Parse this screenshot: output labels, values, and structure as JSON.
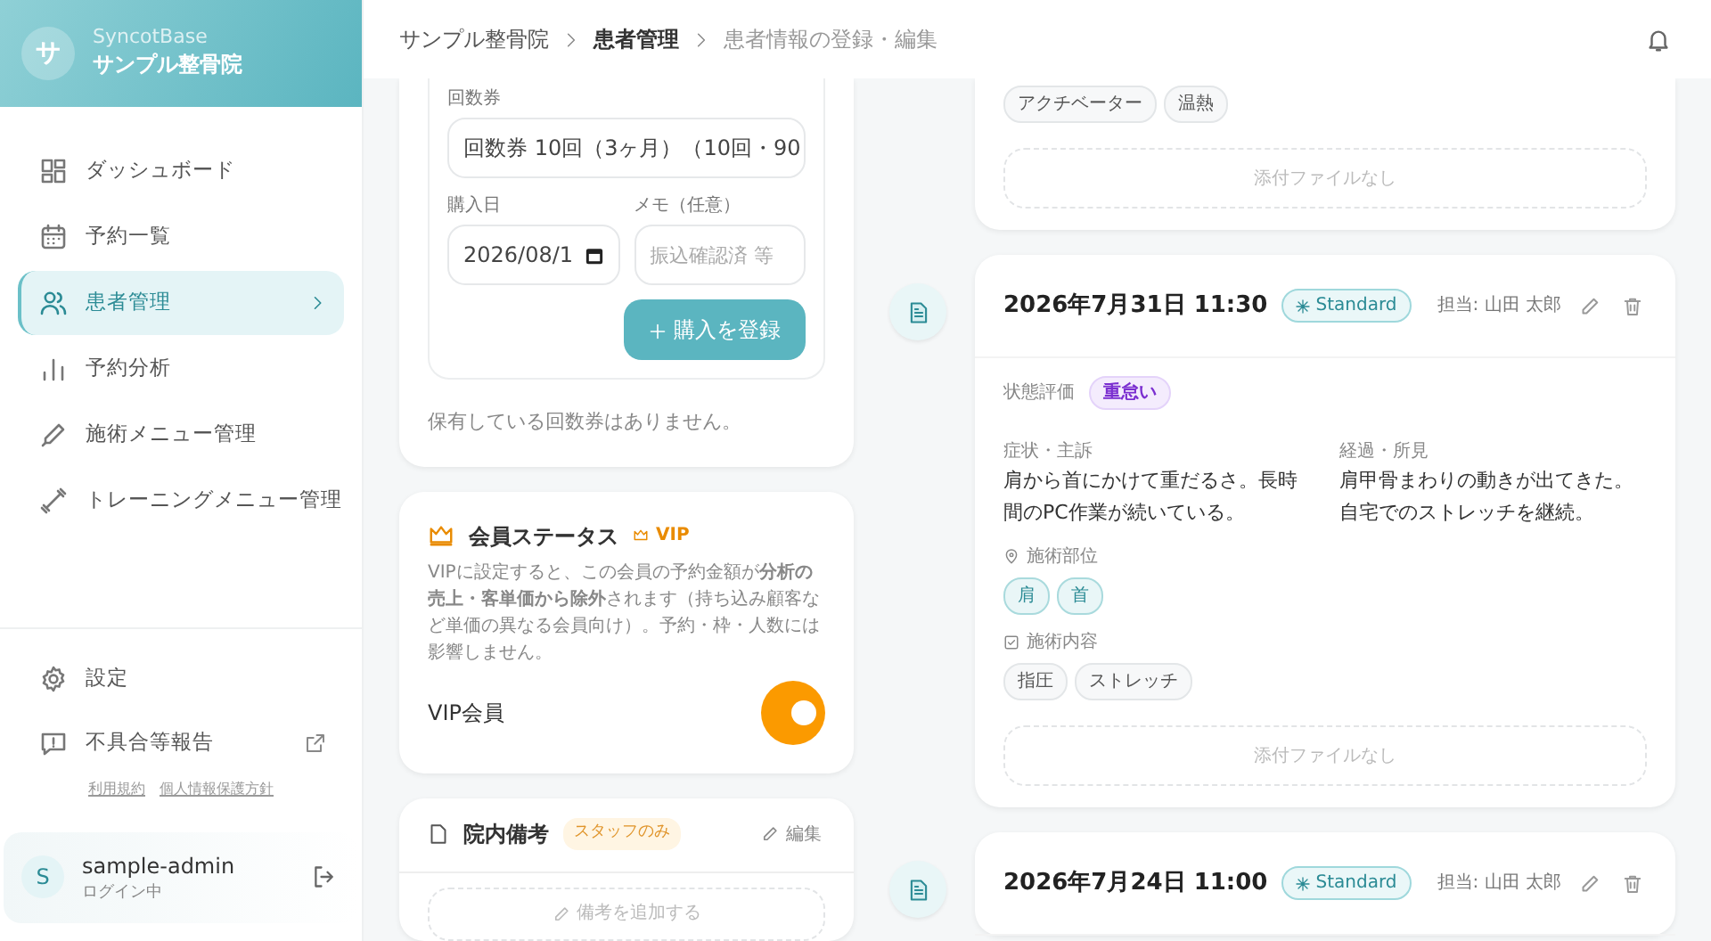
{
  "sidebar": {
    "avatar_letter": "サ",
    "app_name": "SyncotBase",
    "clinic_name": "サンプル整骨院",
    "nav": [
      {
        "label": "ダッシュボード",
        "kind": "dashboard",
        "selected": false
      },
      {
        "label": "予約一覧",
        "kind": "calendar",
        "selected": false
      },
      {
        "label": "患者管理",
        "kind": "patients",
        "selected": true
      },
      {
        "label": "予約分析",
        "kind": "chart",
        "selected": false
      },
      {
        "label": "施術メニュー管理",
        "kind": "pen",
        "selected": false
      },
      {
        "label": "トレーニングメニュー管理",
        "kind": "dumbbell",
        "selected": false
      }
    ],
    "footer_items": [
      {
        "label": "設定",
        "kind": "settings",
        "external": false
      },
      {
        "label": "不具合等報告",
        "kind": "report",
        "external": true
      }
    ],
    "legal_links": [
      "利用規約",
      "個人情報保護方針"
    ],
    "user": {
      "initial": "S",
      "name": "sample-admin",
      "status": "ログイン中"
    }
  },
  "breadcrumb": [
    {
      "label": "サンプル整骨院",
      "kind": "link"
    },
    {
      "label": "患者管理",
      "kind": "strong"
    },
    {
      "label": "患者情報の登録・編集",
      "kind": "current"
    }
  ],
  "ticket_form": {
    "ticket_label": "回数券",
    "ticket_value": "回数券 10回（3ヶ月）（10回・90",
    "date_label": "購入日",
    "date_value": "2026/08/1",
    "memo_label": "メモ（任意）",
    "memo_placeholder": "振込確認済 等",
    "submit_label": "購入を登録"
  },
  "tickets_empty": "保有している回数券はありません。",
  "member_status": {
    "title": "会員ステータス",
    "badge": "VIP",
    "description": "VIPに設定すると、この会員の予約金額が**分析の売上・客単価から除外**されます（持ち込み顧客など単価の異なる会員向け）。予約・枠・人数には影響しません。",
    "toggle_label": "VIP会員",
    "vip_on": true
  },
  "notes": {
    "title": "院内備考",
    "badge": "スタッフのみ",
    "edit_label": "編集",
    "add_label": "備考を追加する"
  },
  "records": [
    {
      "contents": [
        "アクチベーター",
        "温熱"
      ],
      "attachment": "添付ファイルなし"
    },
    {
      "datetime": "2026年7月31日 11:30",
      "plan": "Standard",
      "staff": "担当: 山田 太郎",
      "condition_label": "状態評価",
      "condition": "重怠い",
      "symptoms_label": "症状・主訴",
      "symptoms": "肩から首にかけて重だるさ。長時間のPC作業が続いている。",
      "progress_label": "経過・所見",
      "progress": "肩甲骨まわりの動きが出てきた。自宅でのストレッチを継続。",
      "area_label": "施術部位",
      "areas": [
        "肩",
        "首"
      ],
      "content_label": "施術内容",
      "contents": [
        "指圧",
        "ストレッチ"
      ],
      "attachment": "添付ファイルなし"
    },
    {
      "datetime": "2026年7月24日 11:00",
      "plan": "Standard",
      "staff": "担当: 山田 太郎"
    }
  ]
}
